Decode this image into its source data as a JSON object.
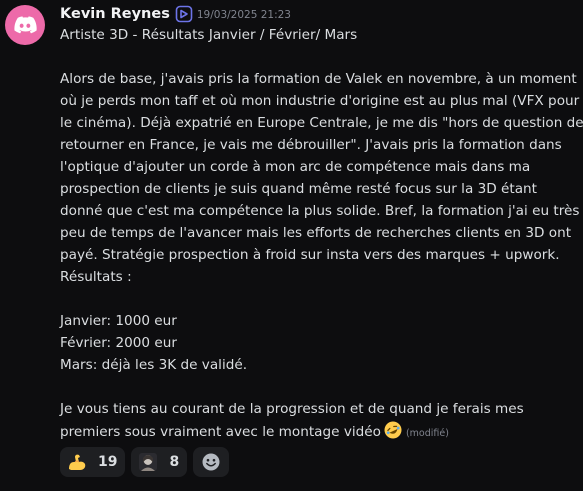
{
  "author": {
    "name": "Kevin Reynes",
    "timestamp": "19/03/2025 21:23",
    "avatar_color": "#ed6aa9",
    "avatar_icon": "discord-logo-icon",
    "badge_icon": "server-tag-badge-icon"
  },
  "message": {
    "lines": [
      "Artiste 3D - Résultats Janvier / Février/ Mars",
      "",
      "Alors de base, j'avais pris la formation de Valek en novembre, à un moment",
      "où je perds mon taff et où mon industrie d'origine est au plus mal (VFX pour",
      "le cinéma). Déjà expatrié en Europe Centrale, je me dis \"hors de question de",
      "retourner en France, je vais me débrouiller\". J'avais pris la formation dans",
      "l'optique d'ajouter un corde à mon arc de compétence mais dans ma",
      "prospection de clients je suis quand même resté focus sur la 3D étant",
      "donné que c'est ma compétence la plus solide. Bref, la formation j'ai eu très",
      "peu de temps de l'avancer mais les efforts de recherches clients en 3D ont",
      "payé. Stratégie prospection à froid sur insta vers des marques + upwork.",
      "Résultats :",
      "",
      "Janvier: 1000 eur",
      "Février: 2000 eur",
      "Mars: déjà les 3K de validé.",
      "",
      "Je vous tiens au courant de la progression et de quand je ferais mes"
    ],
    "last_line": "premiers sous vraiment avec le montage vidéo",
    "last_emoji": "rofl-emoji",
    "edited_label": "(modifié)"
  },
  "reactions": [
    {
      "emoji": "flexed-biceps-emoji",
      "count": "19"
    },
    {
      "emoji": "custom-portrait-emoji",
      "count": "8"
    }
  ],
  "add_reaction_icon": "add-reaction-smiley-icon"
}
